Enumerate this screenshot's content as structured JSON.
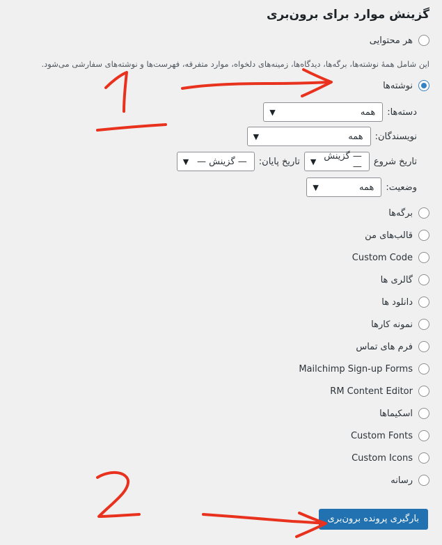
{
  "heading": "گزینش موارد برای برون‌بری",
  "all_content": {
    "label": "هر محتوایی",
    "description": "این شامل همهٔ نوشته‌ها، برگه‌ها، دیدگاه‌ها، زمینه‌های دلخواه، موارد متفرقه، فهرست‌ها و نوشته‌های سفارشی می‌شود."
  },
  "posts": {
    "label": "نوشته‌ها",
    "filters": {
      "categories": {
        "label": "دسته‌ها:",
        "value": "همه"
      },
      "authors": {
        "label": "نویسندگان:",
        "value": "همه"
      },
      "start_date": {
        "label": "تاریخ شروع",
        "value": "— گزینش —"
      },
      "end_date": {
        "label": "تاریخ پایان:",
        "value": "— گزینش —"
      },
      "status": {
        "label": "وضعیت:",
        "value": "همه"
      }
    }
  },
  "options": [
    "برگه‌ها",
    "قالب‌های من",
    "Custom Code",
    "گالری ها",
    "دانلود ها",
    "نمونه کارها",
    "فرم های تماس",
    "Mailchimp Sign-up Forms",
    "RM Content Editor",
    "اسکیماها",
    "Custom Fonts",
    "Custom Icons",
    "رسانه"
  ],
  "submit_label": "بارگیری پرونده برون‌بری",
  "annotations": [
    "1",
    "2"
  ],
  "colors": {
    "accent": "#2271b1",
    "annotation": "#e8321e"
  }
}
